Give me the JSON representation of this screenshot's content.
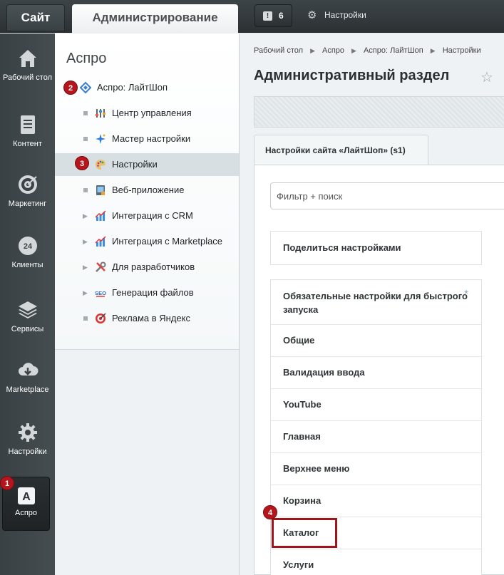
{
  "topbar": {
    "site_tab": "Сайт",
    "admin_tab": "Администрирование",
    "notifications_count": "6",
    "settings_link": "Настройки"
  },
  "leftbar": {
    "items": [
      {
        "label": "Рабочий стол",
        "icon": "home-icon"
      },
      {
        "label": "Контент",
        "icon": "document-icon"
      },
      {
        "label": "Маркетинг",
        "icon": "target-icon"
      },
      {
        "label": "Клиенты",
        "icon": "clients-24-icon"
      },
      {
        "label": "Сервисы",
        "icon": "layers-icon"
      },
      {
        "label": "Marketplace",
        "icon": "cloud-download-icon"
      },
      {
        "label": "Настройки",
        "icon": "gear-icon"
      },
      {
        "label": "Аспро",
        "icon": "aspro-logo-icon",
        "glyph": "A"
      }
    ]
  },
  "menu": {
    "title": "Аспро",
    "root_item": "Аспро: ЛайтШоп",
    "items": [
      {
        "label": "Центр управления",
        "icon": "control-center-icon"
      },
      {
        "label": "Мастер настройки",
        "icon": "wizard-sparkle-icon"
      },
      {
        "label": "Настройки",
        "icon": "palette-icon"
      },
      {
        "label": "Веб-приложение",
        "icon": "web-app-icon"
      },
      {
        "label": "Интеграция с CRM",
        "icon": "chart-icon"
      },
      {
        "label": "Интеграция с Marketplace",
        "icon": "chart-icon"
      },
      {
        "label": "Для разработчиков",
        "icon": "tools-icon"
      },
      {
        "label": "Генерация файлов",
        "icon": "seo-icon",
        "glyph": "SEO"
      },
      {
        "label": "Реклама в Яндекс",
        "icon": "target-ad-icon"
      }
    ]
  },
  "content": {
    "breadcrumbs": [
      "Рабочий стол",
      "Аспро",
      "Аспро: ЛайтШоп",
      "Настройки"
    ],
    "page_title": "Административный раздел",
    "tab_label": "Настройки сайта «ЛайтШоп» (s1)",
    "filter_placeholder": "Фильтр + поиск",
    "share_label": "Поделиться настройками",
    "sections": [
      "Обязательные настройки для быстрого запуска",
      "Общие",
      "Валидация ввода",
      "YouTube",
      "Главная",
      "Верхнее меню",
      "Корзина",
      "Каталог",
      "Услуги"
    ],
    "required_mark": "*"
  },
  "markers": [
    "1",
    "2",
    "3",
    "4"
  ],
  "colors": {
    "marker_red": "#b5161d",
    "highlight_border": "#a0151b",
    "topbar_dark": "#2c3134",
    "sidebar_dark": "#3a4145"
  }
}
